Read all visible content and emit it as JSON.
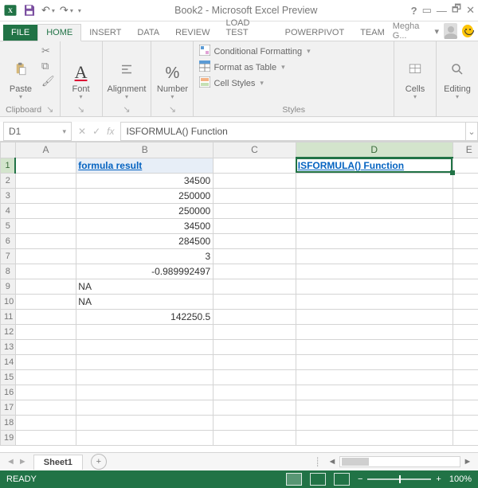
{
  "window": {
    "title": "Book2 - Microsoft Excel Preview",
    "username": "Megha G..."
  },
  "tabs": {
    "file": "FILE",
    "items": [
      "HOME",
      "INSERT",
      "DATA",
      "REVIEW",
      "LOAD TEST",
      "POWERPIVOT",
      "TEAM"
    ],
    "active": "HOME"
  },
  "ribbon": {
    "clipboard": {
      "paste": "Paste",
      "label": "Clipboard"
    },
    "font": {
      "label": "Font",
      "big": "Font",
      "sample": "A"
    },
    "alignment": {
      "label": "Alignment",
      "big": "Alignment"
    },
    "number": {
      "label": "Number",
      "big": "Number",
      "sample": "%"
    },
    "styles": {
      "label": "Styles",
      "cond": "Conditional Formatting",
      "table": "Format as Table",
      "cell": "Cell Styles"
    },
    "cells": {
      "label": "Cells",
      "big": "Cells"
    },
    "editing": {
      "label": "Editing",
      "big": "Editing"
    }
  },
  "formula_bar": {
    "namebox": "D1",
    "value": "ISFORMULA() Function"
  },
  "columns": [
    "A",
    "B",
    "C",
    "D",
    "E"
  ],
  "active_cell": {
    "row": 1,
    "col": "D"
  },
  "cells": {
    "B1": {
      "v": "formula result",
      "t": "header"
    },
    "D1": {
      "v": "ISFORMULA() Function",
      "t": "active"
    },
    "B2": {
      "v": "34500",
      "t": "num"
    },
    "B3": {
      "v": "250000",
      "t": "num"
    },
    "B4": {
      "v": "250000",
      "t": "num"
    },
    "B5": {
      "v": "34500",
      "t": "num"
    },
    "B6": {
      "v": "284500",
      "t": "num"
    },
    "B7": {
      "v": "3",
      "t": "num"
    },
    "B8": {
      "v": "-0.989992497",
      "t": "num"
    },
    "B9": {
      "v": "NA",
      "t": "text"
    },
    "B10": {
      "v": "NA",
      "t": "text"
    },
    "B11": {
      "v": "142250.5",
      "t": "num"
    }
  },
  "sheet": {
    "name": "Sheet1"
  },
  "status": {
    "ready": "READY",
    "zoom": "100%"
  }
}
